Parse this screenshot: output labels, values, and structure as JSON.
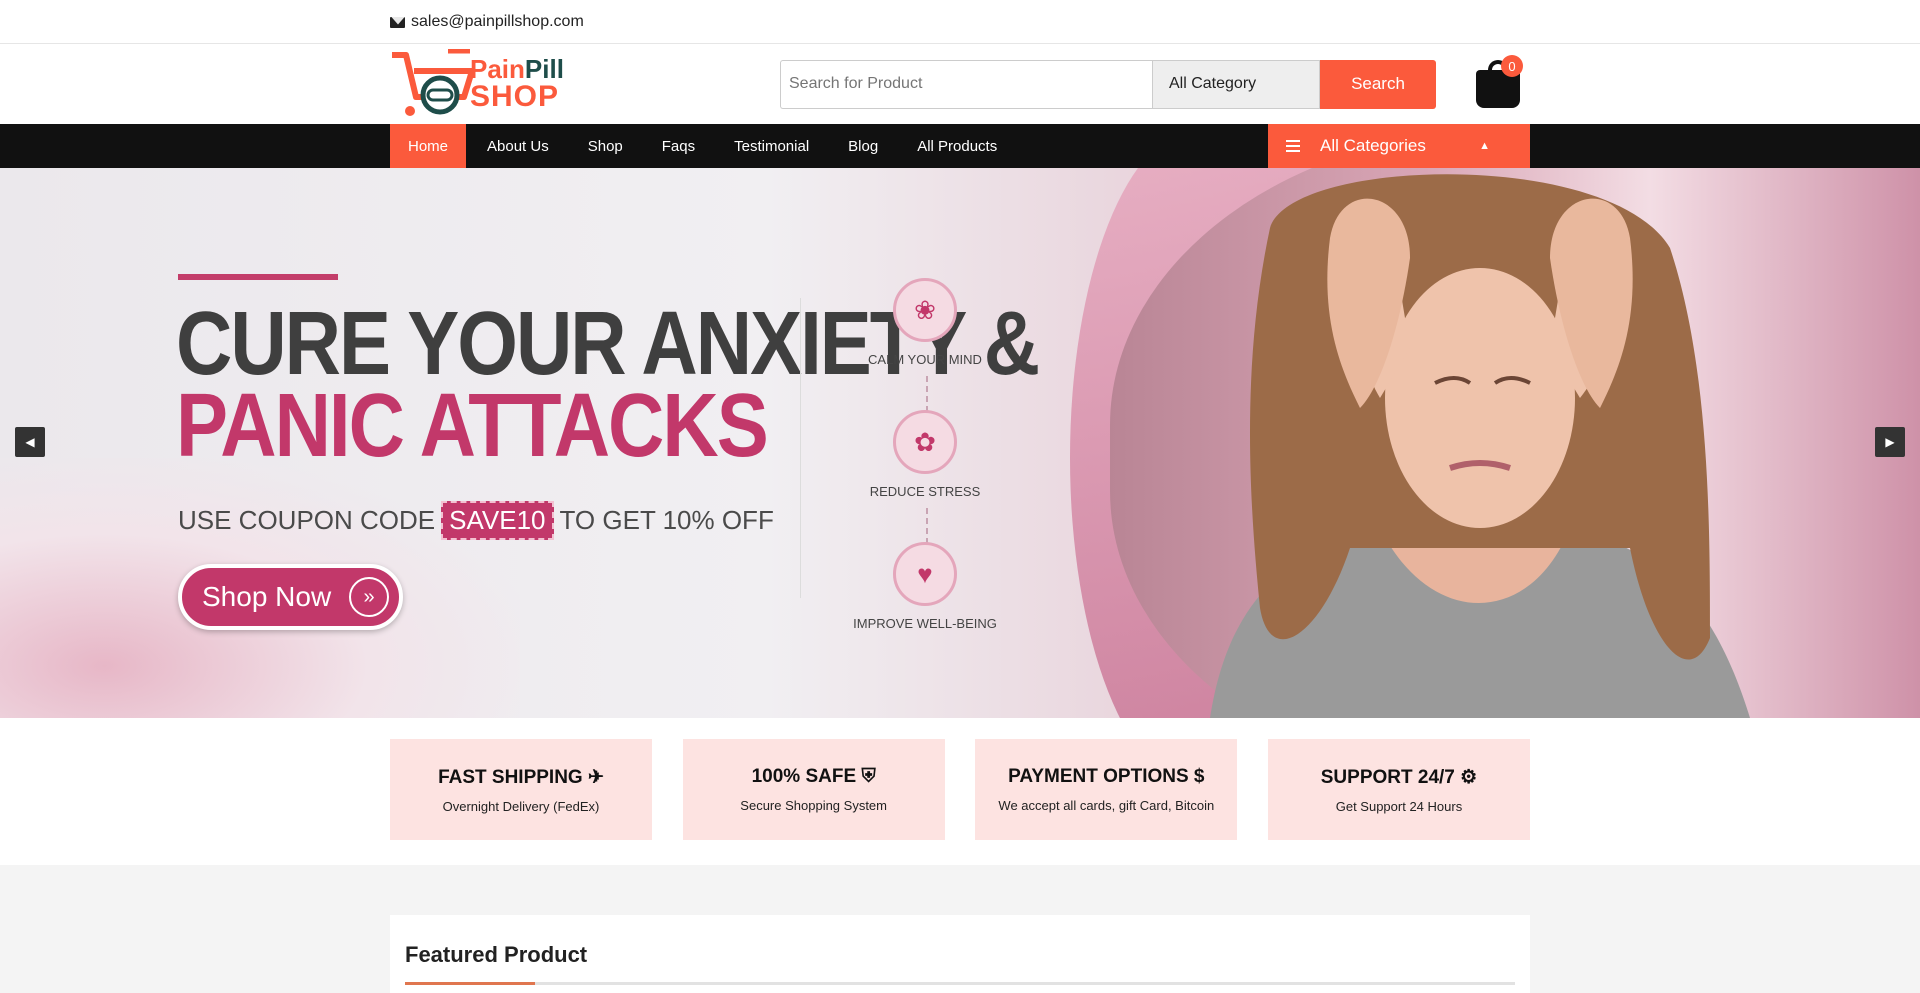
{
  "topbar": {
    "email": "sales@painpillshop.com"
  },
  "header": {
    "logo_line1_a": "Pain",
    "logo_line1_b": "Pill",
    "logo_line2": "SHOP",
    "search_placeholder": "Search for Product",
    "category_selected": "All Category",
    "search_label": "Search",
    "cart_count": "0"
  },
  "nav": {
    "items": [
      "Home",
      "About Us",
      "Shop",
      "Faqs",
      "Testimonial",
      "Blog",
      "All Products"
    ],
    "active": "Home",
    "all_categories": "All Categories"
  },
  "hero": {
    "headline_1": "CURE YOUR ANXIETY &",
    "headline_2": "PANIC ATTACKS",
    "coupon_prefix": "USE COUPON CODE",
    "coupon_code": "SAVE10",
    "coupon_suffix": "TO GET 10% OFF",
    "cta": "Shop Now",
    "benefits": [
      "CALM YOUR MIND",
      "REDUCE STRESS",
      "IMPROVE WELL-BEING"
    ]
  },
  "features": [
    {
      "title": "FAST SHIPPING",
      "icon": "plane-icon",
      "subtitle": "Overnight Delivery (FedEx)"
    },
    {
      "title": "100% SAFE",
      "icon": "shield-icon",
      "subtitle": "Secure Shopping System"
    },
    {
      "title": "PAYMENT OPTIONS $",
      "icon": "dollar-icon",
      "subtitle": "We accept all cards, gift Card, Bitcoin"
    },
    {
      "title": "SUPPORT 24/7",
      "icon": "gear-icon",
      "subtitle": "Get Support 24 Hours"
    }
  ],
  "featured": {
    "title": "Featured Product"
  },
  "colors": {
    "accent": "#fb5a3c",
    "nav_bg": "#111111",
    "hero_pink": "#c2386a",
    "feature_bg": "#fde3e1"
  }
}
